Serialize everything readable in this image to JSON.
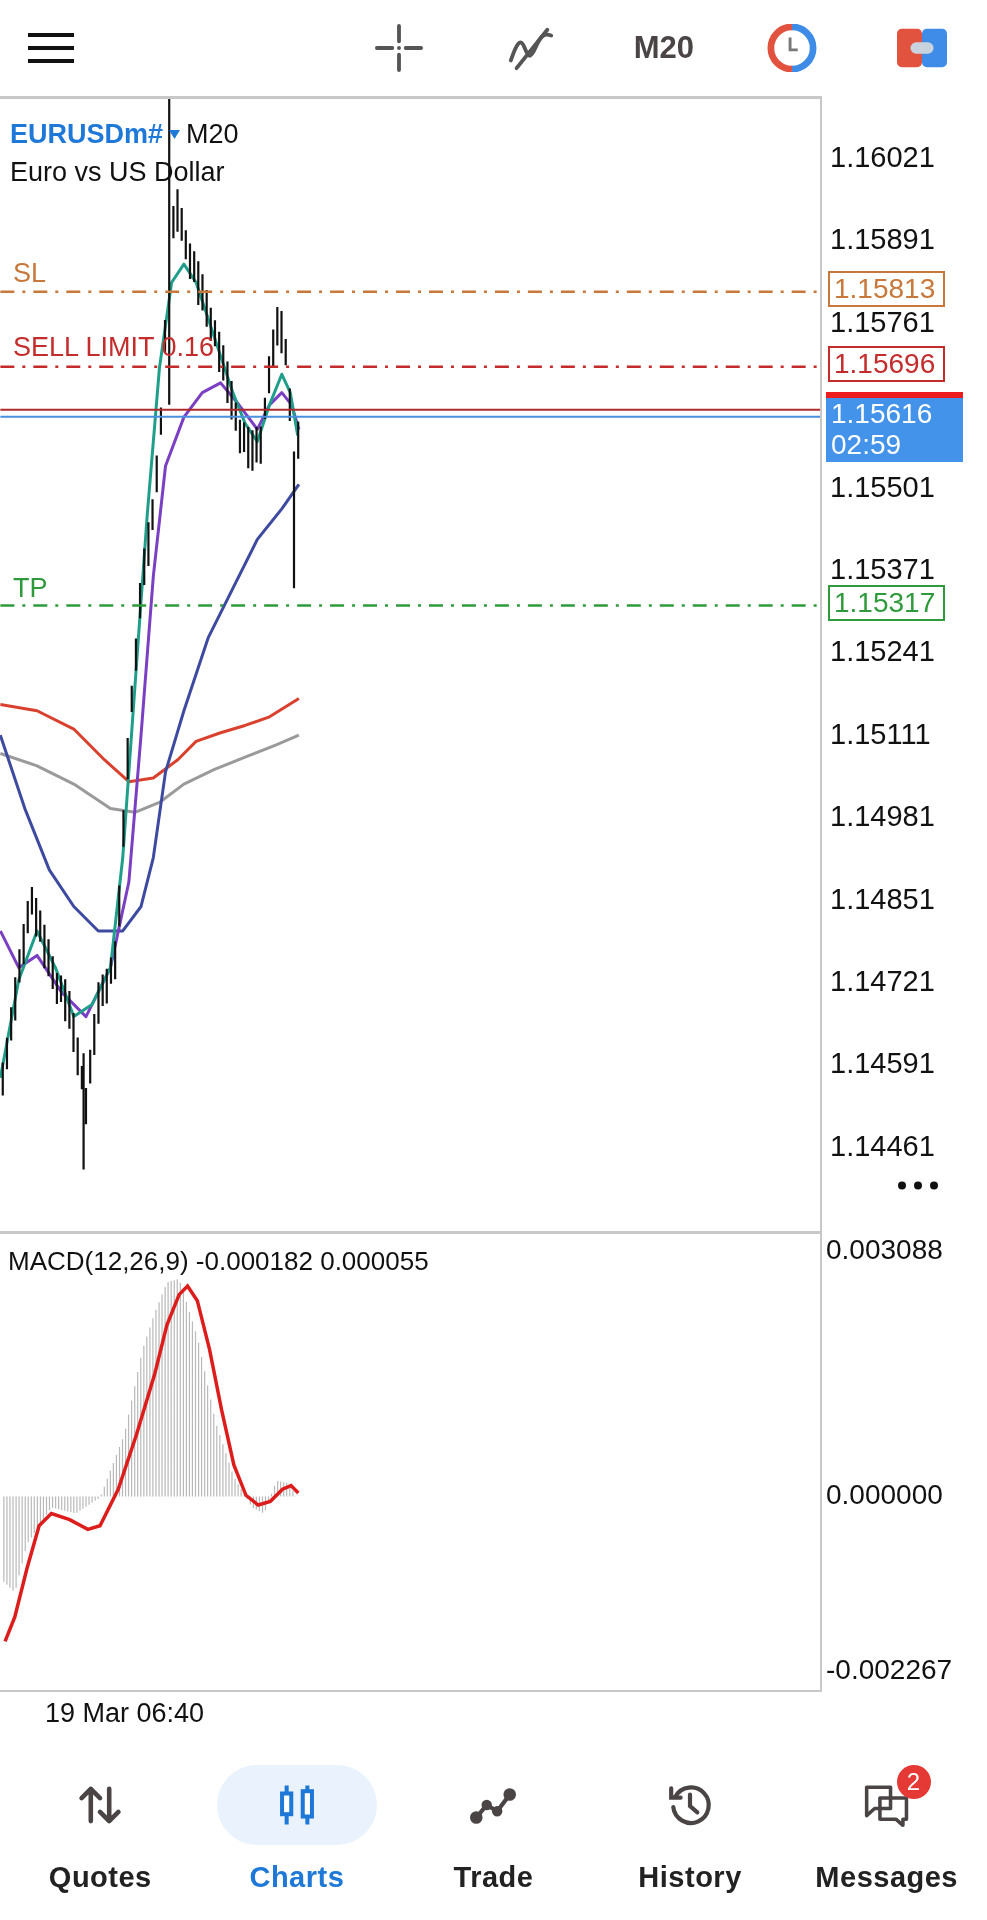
{
  "toolbar": {
    "timeframe": "M20"
  },
  "chart": {
    "symbol": "EURUSDm#",
    "timeframe": "M20",
    "description": "Euro vs US Dollar",
    "price_ticks": [
      "1.16021",
      "1.15891",
      "1.15761",
      "1.15501",
      "1.15371",
      "1.15241",
      "1.15111",
      "1.14981",
      "1.14851",
      "1.14721",
      "1.14591",
      "1.14461"
    ],
    "order_lines": [
      {
        "label": "SL",
        "price": "1.15813",
        "color": "#c8783a"
      },
      {
        "label": "SELL LIMIT 0.16",
        "price": "1.15696",
        "color": "#c42b2b"
      },
      {
        "label": "TP",
        "price": "1.15317",
        "color": "#2f9a3c"
      }
    ],
    "current_price": {
      "price": "1.15616",
      "countdown": "02:59"
    }
  },
  "macd": {
    "label": "MACD(12,26,9) -0.000182 0.000055",
    "ticks": [
      "0.003088",
      "0.000000",
      "-0.002267"
    ]
  },
  "time_axis": {
    "label": "19 Mar 06:40"
  },
  "nav": [
    {
      "kind": "quotes",
      "label": "Quotes",
      "selected": false
    },
    {
      "kind": "charts",
      "label": "Charts",
      "selected": true
    },
    {
      "kind": "trade",
      "label": "Trade",
      "selected": false
    },
    {
      "kind": "history",
      "label": "History",
      "selected": false
    },
    {
      "kind": "messages",
      "label": "Messages",
      "selected": false,
      "badge": "2"
    }
  ]
}
